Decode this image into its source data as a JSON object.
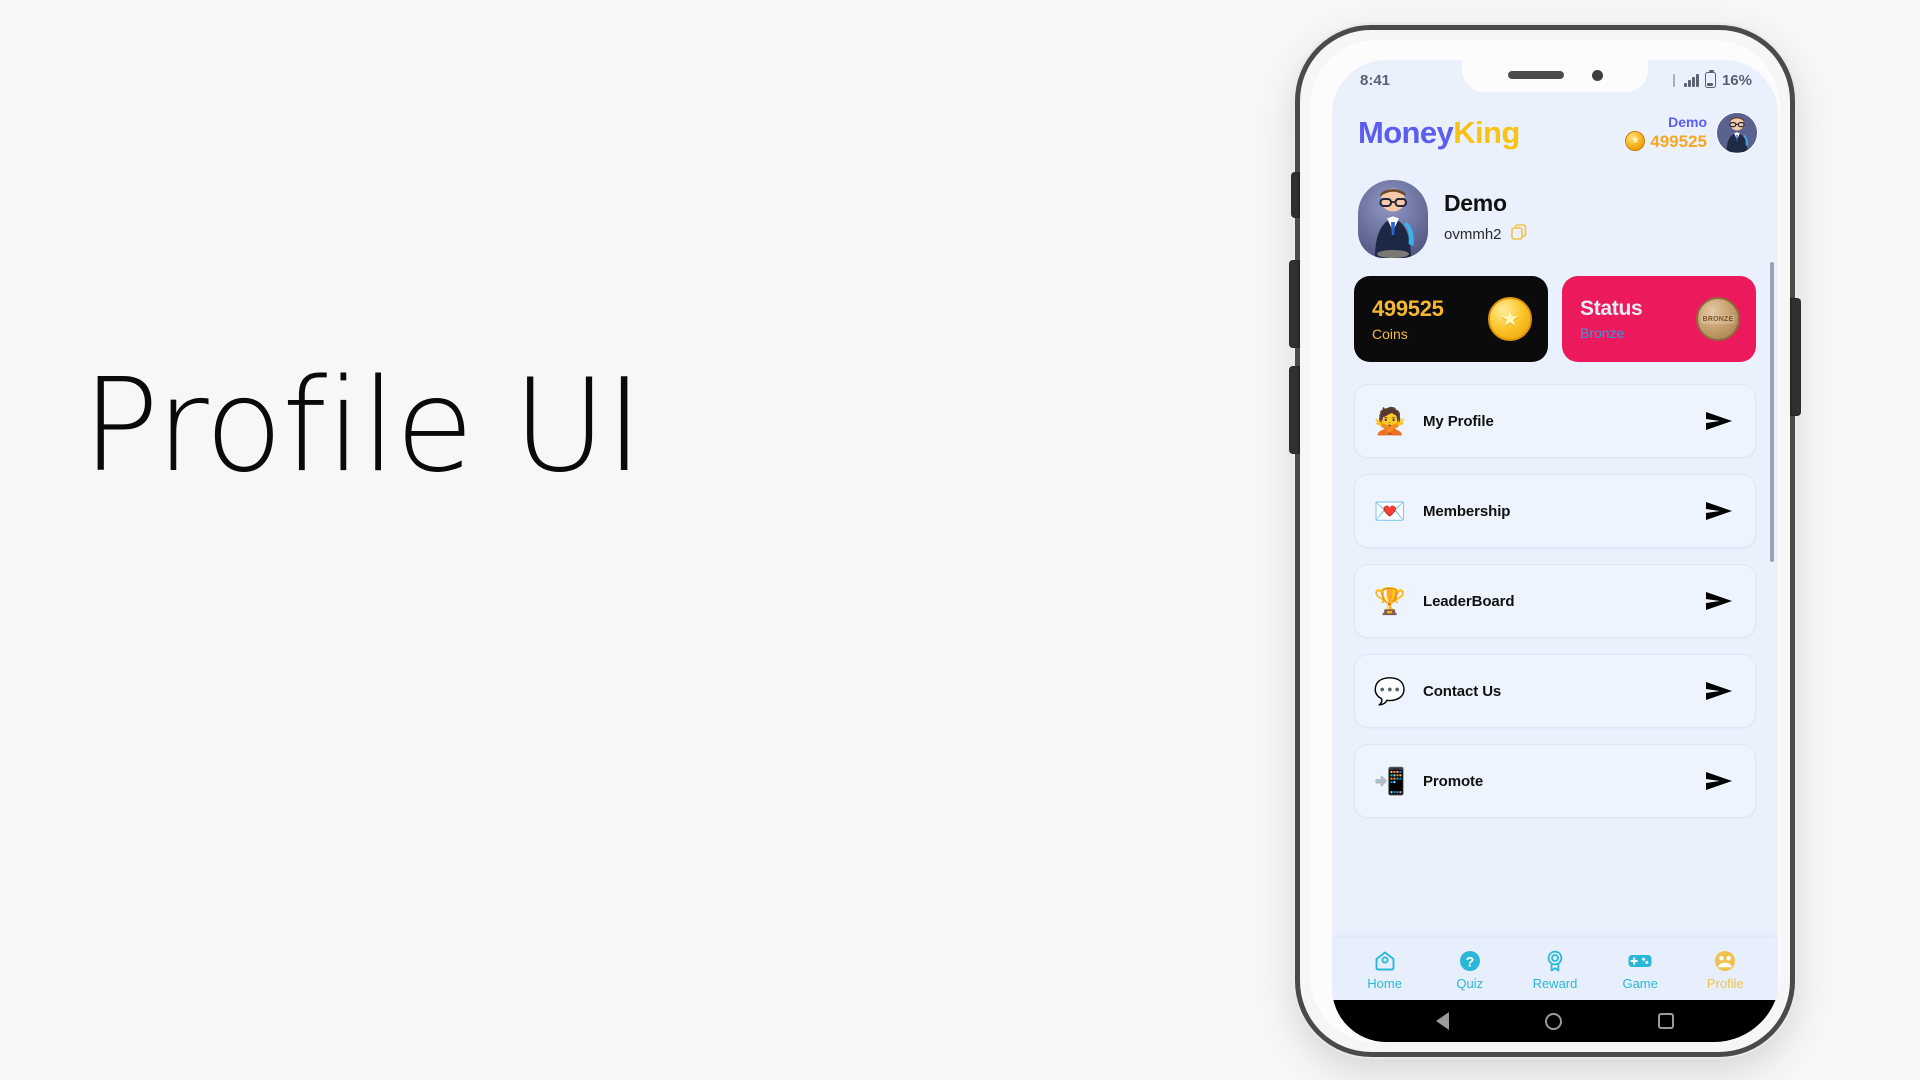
{
  "caption": {
    "text": "Profile UI"
  },
  "device": {
    "statusbar": {
      "time": "8:41",
      "battery_percent": "16%",
      "signal_icon": "signal-bars-icon",
      "battery_icon": "battery-icon"
    },
    "android_nav": {
      "back": "back-triangle-icon",
      "home": "home-circle-icon",
      "recents": "recents-square-icon"
    }
  },
  "app": {
    "header": {
      "logo_part1": "Money",
      "logo_part2": "King",
      "logo_color1": "#5b5cf0",
      "logo_color2": "#f9c315",
      "user_name": "Demo",
      "coins": "499525",
      "coin_icon": "coin-icon",
      "avatar_icon": "user-avatar"
    },
    "profile": {
      "name": "Demo",
      "user_id": "ovmmh2",
      "copy_icon": "copy-icon",
      "avatar_icon": "user-avatar-large"
    },
    "stats": {
      "coins_card": {
        "value": "499525",
        "label": "Coins",
        "icon": "star-coin-icon",
        "bg_color": "#0b0b0b",
        "value_color": "#f5b731"
      },
      "status_card": {
        "title": "Status",
        "value": "Bronze",
        "icon": "bronze-medal-icon",
        "medal_text": "BRONZE",
        "bg_color": "#ec1a5c",
        "value_color": "#2f9be0"
      }
    },
    "menu": {
      "items": [
        {
          "label": "My Profile",
          "icon": "person-gesture-icon",
          "emoji": "🙅",
          "arrow": "send-arrow-icon"
        },
        {
          "label": "Membership",
          "icon": "gem-icon",
          "emoji": "💌",
          "arrow": "send-arrow-icon"
        },
        {
          "label": "LeaderBoard",
          "icon": "podium-icon",
          "emoji": "🏆",
          "arrow": "send-arrow-icon"
        },
        {
          "label": "Contact Us",
          "icon": "speech-balloon-icon",
          "emoji": "💬",
          "arrow": "send-arrow-icon"
        },
        {
          "label": "Promote",
          "icon": "mobile-share-icon",
          "emoji": "📲",
          "arrow": "send-arrow-icon"
        }
      ]
    },
    "bottom_nav": {
      "active_color": "#efc24f",
      "inactive_color": "#2bb8d8",
      "items": [
        {
          "label": "Home",
          "icon": "home-icon",
          "active": false
        },
        {
          "label": "Quiz",
          "icon": "quiz-icon",
          "active": false
        },
        {
          "label": "Reward",
          "icon": "reward-icon",
          "active": false
        },
        {
          "label": "Game",
          "icon": "gamepad-icon",
          "active": false
        },
        {
          "label": "Profile",
          "icon": "profile-icon",
          "active": true
        }
      ]
    }
  }
}
